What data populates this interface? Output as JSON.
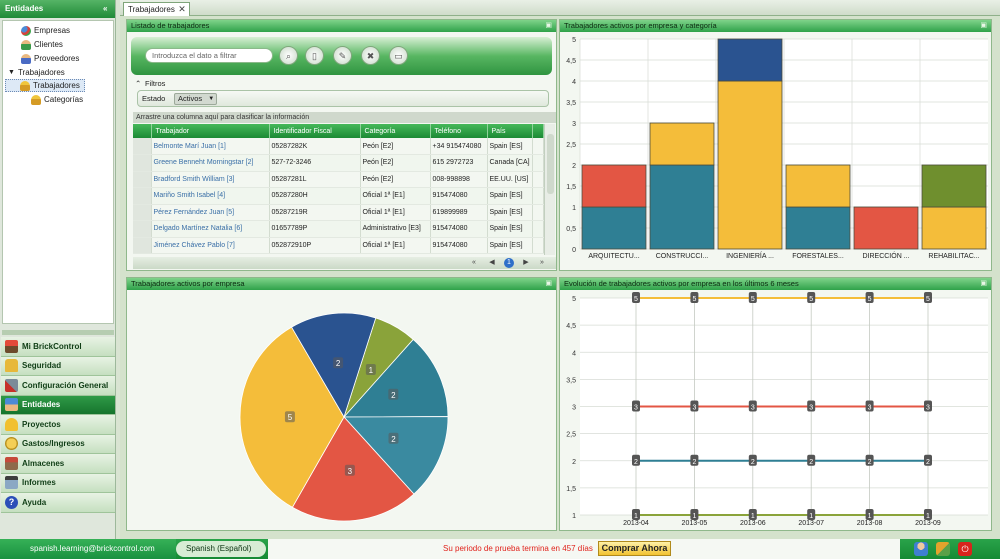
{
  "sidebar": {
    "header": "Entidades",
    "collapse_glyph": "«",
    "tree": [
      {
        "label": "Empresas",
        "icon": "companies-icon"
      },
      {
        "label": "Clientes",
        "icon": "client-icon"
      },
      {
        "label": "Proveedores",
        "icon": "supplier-icon"
      },
      {
        "label": "Trabajadores",
        "icon": "folder-expand-icon"
      },
      {
        "label": "Trabajadores",
        "icon": "workers-icon"
      },
      {
        "label": "Categorías",
        "icon": "categories-icon"
      }
    ],
    "nav": [
      {
        "label": "Mi BrickControl",
        "icon": "home-icon"
      },
      {
        "label": "Seguridad",
        "icon": "lock-icon"
      },
      {
        "label": "Configuración General",
        "icon": "tools-icon"
      },
      {
        "label": "Entidades",
        "icon": "entities-icon"
      },
      {
        "label": "Proyectos",
        "icon": "helmet-icon"
      },
      {
        "label": "Gastos/Ingresos",
        "icon": "coins-icon"
      },
      {
        "label": "Almacenes",
        "icon": "warehouse-icon"
      },
      {
        "label": "Informes",
        "icon": "report-icon"
      },
      {
        "label": "Ayuda",
        "icon": "help-icon"
      }
    ],
    "active_nav": "Entidades"
  },
  "tabbar": {
    "tab_label": "Trabajadores",
    "close_glyph": "✕"
  },
  "workers_panel": {
    "title": "Listado de trabajadores",
    "search_placeholder": "Introduzca el dato a filtrar",
    "filters_label": "Filtros",
    "state_label": "Estado",
    "state_value": "Activos",
    "drag_hint": "Arrastre una columna aquí para clasificar la información",
    "columns": [
      "Trabajador",
      "Identificador Fiscal",
      "Categoría",
      "Teléfono",
      "País"
    ],
    "rows": [
      [
        "Belmonte Marí Juan [1]",
        "05287282K",
        "Peón [E2]",
        "+34 915474080",
        "Spain [ES]"
      ],
      [
        "Greene Benneht Morningstar [2]",
        "527-72-3246",
        "Peón [E2]",
        "615 2972723",
        "Canada [CA]"
      ],
      [
        "Bradford Smith William [3]",
        "05287281L",
        "Peón [E2]",
        "008-998898",
        "EE.UU. [US]"
      ],
      [
        "Mariño Smith Isabel [4]",
        "05287280H",
        "Oficial 1ª [E1]",
        "915474080",
        "Spain [ES]"
      ],
      [
        "Pérez Fernández Juan [5]",
        "05287219R",
        "Oficial 1ª [E1]",
        "619899989",
        "Spain [ES]"
      ],
      [
        "Delgado Martínez Natalia [6]",
        "01657789P",
        "Administrativo [E3]",
        "915474080",
        "Spain [ES]"
      ],
      [
        "Jiménez Chávez Pablo [7]",
        "052872910P",
        "Oficial 1ª [E1]",
        "915474080",
        "Spain [ES]"
      ]
    ],
    "current_page": "1"
  },
  "bar_panel": {
    "title": "Trabajadores activos por empresa y categoría"
  },
  "pie_panel": {
    "title": "Trabajadores activos por empresa"
  },
  "line_panel": {
    "title": "Evolución de trabajadores activos por empresa en los últimos 6 meses"
  },
  "chart_data": [
    {
      "type": "bar",
      "stacked": true,
      "categories": [
        "ARQUITECTU...",
        "CONSTRUCCI...",
        "INGENIERÍA ...",
        "FORESTALES...",
        "DIRECCIÓN ...",
        "REHABILITAC..."
      ],
      "ylim": [
        0,
        5
      ],
      "yticks": [
        "0",
        "0,5",
        "1",
        "1,5",
        "2",
        "2,5",
        "3",
        "3,5",
        "4",
        "4,5",
        "5"
      ],
      "segments": [
        [
          {
            "value": 1,
            "color": "#2f7f94"
          },
          {
            "value": 1,
            "color": "#e35644"
          }
        ],
        [
          {
            "value": 2,
            "color": "#2f7f94"
          },
          {
            "value": 1,
            "color": "#f4bd3a"
          }
        ],
        [
          {
            "value": 4,
            "color": "#f4bd3a"
          },
          {
            "value": 1,
            "color": "#2a5390"
          }
        ],
        [
          {
            "value": 1,
            "color": "#2f7f94"
          },
          {
            "value": 1,
            "color": "#f4bd3a"
          }
        ],
        [
          {
            "value": 1,
            "color": "#e35644"
          }
        ],
        [
          {
            "value": 1,
            "color": "#f4bd3a"
          },
          {
            "value": 1,
            "color": "#6f8f2e"
          }
        ]
      ],
      "grid": true
    },
    {
      "type": "pie",
      "slices": [
        {
          "value": 1,
          "label": "1",
          "color": "#8aa33a"
        },
        {
          "value": 2,
          "label": "2",
          "color": "#2f7f94"
        },
        {
          "value": 2,
          "label": "2",
          "color": "#3a8aa0"
        },
        {
          "value": 3,
          "label": "3",
          "color": "#e35644"
        },
        {
          "value": 5,
          "label": "5",
          "color": "#f4bd3a"
        },
        {
          "value": 2,
          "label": "2",
          "color": "#2a5390"
        }
      ]
    },
    {
      "type": "line",
      "x": [
        "2013-04",
        "2013-05",
        "2013-06",
        "2013-07",
        "2013-08",
        "2013-09"
      ],
      "ylim": [
        1,
        5
      ],
      "yticks": [
        "1",
        "1,5",
        "2",
        "2,5",
        "3",
        "3,5",
        "4",
        "4,5",
        "5"
      ],
      "series": [
        {
          "values": [
            5,
            5,
            5,
            5,
            5,
            5
          ],
          "color": "#f4bd3a"
        },
        {
          "values": [
            3,
            3,
            3,
            3,
            3,
            3
          ],
          "color": "#e35644"
        },
        {
          "values": [
            2,
            2,
            2,
            2,
            2,
            2
          ],
          "color": "#2f7f94"
        },
        {
          "values": [
            1,
            1,
            1,
            1,
            1,
            1
          ],
          "color": "#8aa33a"
        }
      ],
      "grid": true
    }
  ],
  "status": {
    "user": "spanish.learning@brickcontrol.com",
    "language": "Spanish (Español)",
    "trial": "Su periodo de prueba termina en 457 días",
    "buy": "Comprar Ahora"
  }
}
